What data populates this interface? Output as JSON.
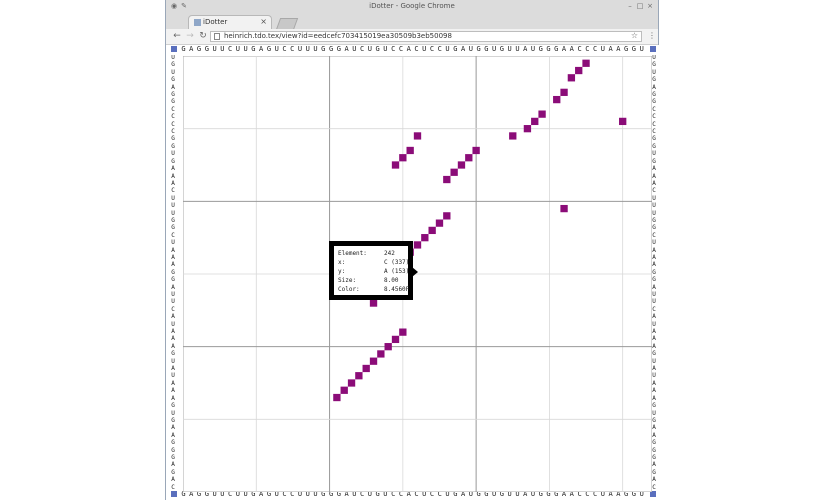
{
  "window": {
    "title": "iDotter - Google Chrome",
    "tab_label": "iDotter",
    "tab_close": "×",
    "url": "heinrich.tdo.tex/view?id=eedcefc703415019ea30509b3eb50098",
    "controls": [
      "–",
      "□",
      "×"
    ]
  },
  "toolbar": {
    "back": "←",
    "forward": "→",
    "reload": "↻",
    "star": "☆",
    "menu": "⋮"
  },
  "sequence": {
    "top": "GAGGUUCUUGAGUCCUUUGGGAUCUGUCCACUCCUGAUGGUGUUAUGGGAACCCUAAGGU",
    "bottom": "GAGGUUCUUGAGUCCUUUGGGAUCUGUCCACUCCUGAUGGUGUUAUGGGAACCCUAAGGU",
    "left": "UGUGAGGCCCCGGUGAAACUUUGGCUAAAGGAUUCAUAAAGUAUAAAGUGAAGGGAGAC",
    "right": "UGUGAGGCCCCGGUGAAACUUUGGCUAAAGGAUUCAUAAAGUAUAAAGUGAAGGGAGAC"
  },
  "accent_color": "#8b0c78",
  "chart_data": {
    "type": "scatter",
    "x_range": [
      0,
      64
    ],
    "y_range": [
      0,
      60
    ],
    "grid": true,
    "color": "#8b0c78",
    "major_lines": [
      20,
      40
    ],
    "minor_step": 10,
    "points": [
      [
        55,
        1
      ],
      [
        54,
        2
      ],
      [
        53,
        3
      ],
      [
        52,
        5
      ],
      [
        51,
        6
      ],
      [
        60,
        9
      ],
      [
        49,
        8
      ],
      [
        48,
        9
      ],
      [
        47,
        10
      ],
      [
        45,
        11
      ],
      [
        32,
        11
      ],
      [
        31,
        13
      ],
      [
        30,
        14
      ],
      [
        29,
        15
      ],
      [
        40,
        13
      ],
      [
        39,
        14
      ],
      [
        38,
        15
      ],
      [
        37,
        16
      ],
      [
        36,
        17
      ],
      [
        52,
        21
      ],
      [
        36,
        22
      ],
      [
        35,
        23
      ],
      [
        34,
        24
      ],
      [
        33,
        25
      ],
      [
        32,
        26
      ],
      [
        31,
        27
      ],
      [
        30,
        28
      ],
      [
        29,
        29
      ],
      [
        28,
        29
      ],
      [
        27,
        29
      ],
      [
        27,
        30
      ],
      [
        26,
        30
      ],
      [
        25,
        30
      ],
      [
        29,
        28
      ],
      [
        26,
        32
      ],
      [
        26,
        34
      ],
      [
        30,
        38
      ],
      [
        29,
        39
      ],
      [
        28,
        40
      ],
      [
        27,
        41
      ],
      [
        26,
        42
      ],
      [
        25,
        43
      ],
      [
        24,
        44
      ],
      [
        23,
        45
      ],
      [
        22,
        46
      ],
      [
        21,
        47
      ]
    ]
  },
  "tooltip": {
    "element_label": "Element:",
    "element_value": "242",
    "x_label": "x:",
    "x_value": "C (337)",
    "y_label": "y:",
    "y_value": "A (153)",
    "size_label": "Size:",
    "size_value": "8.00",
    "color_label": "Color:",
    "color_value": "8.4560F"
  }
}
